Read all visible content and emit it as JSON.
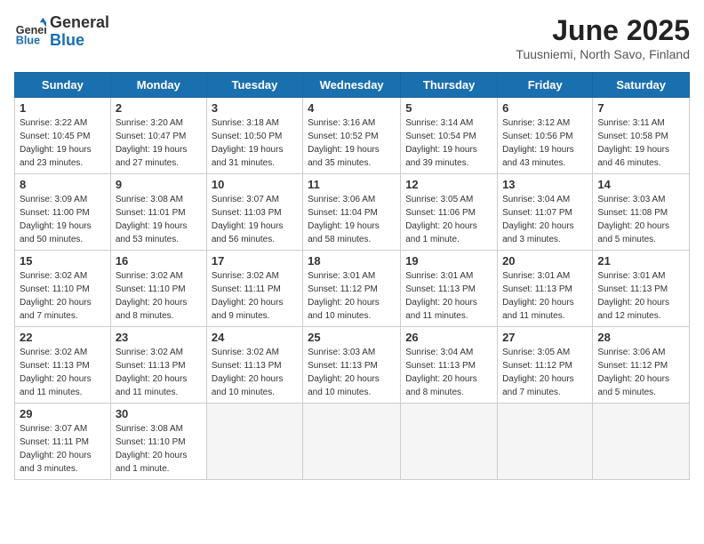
{
  "header": {
    "logo": {
      "general": "General",
      "blue": "Blue"
    },
    "title": "June 2025",
    "location": "Tuusniemi, North Savo, Finland"
  },
  "days_of_week": [
    "Sunday",
    "Monday",
    "Tuesday",
    "Wednesday",
    "Thursday",
    "Friday",
    "Saturday"
  ],
  "weeks": [
    [
      {
        "day": "1",
        "sunrise": "Sunrise: 3:22 AM",
        "sunset": "Sunset: 10:45 PM",
        "daylight": "Daylight: 19 hours and 23 minutes."
      },
      {
        "day": "2",
        "sunrise": "Sunrise: 3:20 AM",
        "sunset": "Sunset: 10:47 PM",
        "daylight": "Daylight: 19 hours and 27 minutes."
      },
      {
        "day": "3",
        "sunrise": "Sunrise: 3:18 AM",
        "sunset": "Sunset: 10:50 PM",
        "daylight": "Daylight: 19 hours and 31 minutes."
      },
      {
        "day": "4",
        "sunrise": "Sunrise: 3:16 AM",
        "sunset": "Sunset: 10:52 PM",
        "daylight": "Daylight: 19 hours and 35 minutes."
      },
      {
        "day": "5",
        "sunrise": "Sunrise: 3:14 AM",
        "sunset": "Sunset: 10:54 PM",
        "daylight": "Daylight: 19 hours and 39 minutes."
      },
      {
        "day": "6",
        "sunrise": "Sunrise: 3:12 AM",
        "sunset": "Sunset: 10:56 PM",
        "daylight": "Daylight: 19 hours and 43 minutes."
      },
      {
        "day": "7",
        "sunrise": "Sunrise: 3:11 AM",
        "sunset": "Sunset: 10:58 PM",
        "daylight": "Daylight: 19 hours and 46 minutes."
      }
    ],
    [
      {
        "day": "8",
        "sunrise": "Sunrise: 3:09 AM",
        "sunset": "Sunset: 11:00 PM",
        "daylight": "Daylight: 19 hours and 50 minutes."
      },
      {
        "day": "9",
        "sunrise": "Sunrise: 3:08 AM",
        "sunset": "Sunset: 11:01 PM",
        "daylight": "Daylight: 19 hours and 53 minutes."
      },
      {
        "day": "10",
        "sunrise": "Sunrise: 3:07 AM",
        "sunset": "Sunset: 11:03 PM",
        "daylight": "Daylight: 19 hours and 56 minutes."
      },
      {
        "day": "11",
        "sunrise": "Sunrise: 3:06 AM",
        "sunset": "Sunset: 11:04 PM",
        "daylight": "Daylight: 19 hours and 58 minutes."
      },
      {
        "day": "12",
        "sunrise": "Sunrise: 3:05 AM",
        "sunset": "Sunset: 11:06 PM",
        "daylight": "Daylight: 20 hours and 1 minute."
      },
      {
        "day": "13",
        "sunrise": "Sunrise: 3:04 AM",
        "sunset": "Sunset: 11:07 PM",
        "daylight": "Daylight: 20 hours and 3 minutes."
      },
      {
        "day": "14",
        "sunrise": "Sunrise: 3:03 AM",
        "sunset": "Sunset: 11:08 PM",
        "daylight": "Daylight: 20 hours and 5 minutes."
      }
    ],
    [
      {
        "day": "15",
        "sunrise": "Sunrise: 3:02 AM",
        "sunset": "Sunset: 11:10 PM",
        "daylight": "Daylight: 20 hours and 7 minutes."
      },
      {
        "day": "16",
        "sunrise": "Sunrise: 3:02 AM",
        "sunset": "Sunset: 11:10 PM",
        "daylight": "Daylight: 20 hours and 8 minutes."
      },
      {
        "day": "17",
        "sunrise": "Sunrise: 3:02 AM",
        "sunset": "Sunset: 11:11 PM",
        "daylight": "Daylight: 20 hours and 9 minutes."
      },
      {
        "day": "18",
        "sunrise": "Sunrise: 3:01 AM",
        "sunset": "Sunset: 11:12 PM",
        "daylight": "Daylight: 20 hours and 10 minutes."
      },
      {
        "day": "19",
        "sunrise": "Sunrise: 3:01 AM",
        "sunset": "Sunset: 11:13 PM",
        "daylight": "Daylight: 20 hours and 11 minutes."
      },
      {
        "day": "20",
        "sunrise": "Sunrise: 3:01 AM",
        "sunset": "Sunset: 11:13 PM",
        "daylight": "Daylight: 20 hours and 11 minutes."
      },
      {
        "day": "21",
        "sunrise": "Sunrise: 3:01 AM",
        "sunset": "Sunset: 11:13 PM",
        "daylight": "Daylight: 20 hours and 12 minutes."
      }
    ],
    [
      {
        "day": "22",
        "sunrise": "Sunrise: 3:02 AM",
        "sunset": "Sunset: 11:13 PM",
        "daylight": "Daylight: 20 hours and 11 minutes."
      },
      {
        "day": "23",
        "sunrise": "Sunrise: 3:02 AM",
        "sunset": "Sunset: 11:13 PM",
        "daylight": "Daylight: 20 hours and 11 minutes."
      },
      {
        "day": "24",
        "sunrise": "Sunrise: 3:02 AM",
        "sunset": "Sunset: 11:13 PM",
        "daylight": "Daylight: 20 hours and 10 minutes."
      },
      {
        "day": "25",
        "sunrise": "Sunrise: 3:03 AM",
        "sunset": "Sunset: 11:13 PM",
        "daylight": "Daylight: 20 hours and 10 minutes."
      },
      {
        "day": "26",
        "sunrise": "Sunrise: 3:04 AM",
        "sunset": "Sunset: 11:13 PM",
        "daylight": "Daylight: 20 hours and 8 minutes."
      },
      {
        "day": "27",
        "sunrise": "Sunrise: 3:05 AM",
        "sunset": "Sunset: 11:12 PM",
        "daylight": "Daylight: 20 hours and 7 minutes."
      },
      {
        "day": "28",
        "sunrise": "Sunrise: 3:06 AM",
        "sunset": "Sunset: 11:12 PM",
        "daylight": "Daylight: 20 hours and 5 minutes."
      }
    ],
    [
      {
        "day": "29",
        "sunrise": "Sunrise: 3:07 AM",
        "sunset": "Sunset: 11:11 PM",
        "daylight": "Daylight: 20 hours and 3 minutes."
      },
      {
        "day": "30",
        "sunrise": "Sunrise: 3:08 AM",
        "sunset": "Sunset: 11:10 PM",
        "daylight": "Daylight: 20 hours and 1 minute."
      },
      null,
      null,
      null,
      null,
      null
    ]
  ]
}
